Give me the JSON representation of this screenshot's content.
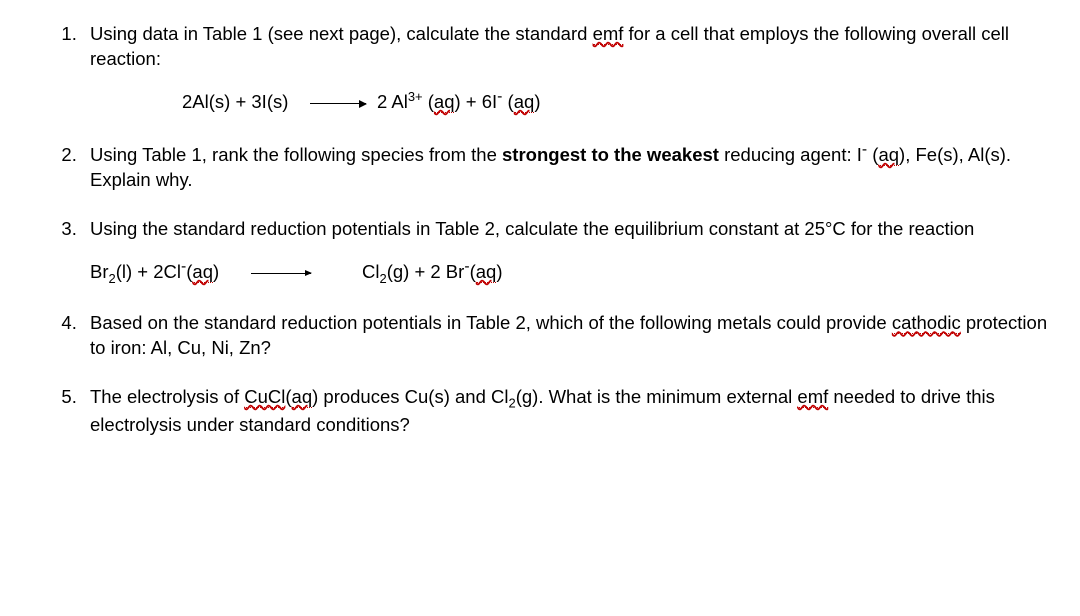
{
  "questions": {
    "q1": {
      "prefix": "Using data in Table 1 (see next page), calculate the standard ",
      "emf": "emf",
      "suffix": " for a cell that employs the following overall cell reaction:",
      "eq_left_a": "2Al(s) + 3I(s)",
      "eq_right_a": " 2 Al",
      "eq_right_b": "3+",
      "eq_right_c": " (",
      "eq_aq1": "aq",
      "eq_right_d": ") + 6I",
      "eq_neg": "-",
      "eq_right_e": " (",
      "eq_aq2": "aq",
      "eq_right_f": ")"
    },
    "q2": {
      "a": "Using Table 1, rank the following species from the ",
      "bold": "strongest to the weakest",
      "b": " reducing agent: I",
      "neg": "-",
      "c": " (",
      "aq": "aq",
      "d": "), Fe(s), Al(s). Explain why."
    },
    "q3": {
      "text": "Using the standard reduction potentials in Table 2, calculate the equilibrium constant at 25°C for the reaction",
      "eq_l1": "Br",
      "eq_l2": "2",
      "eq_l3": "(l) + 2Cl",
      "eq_lneg": "-",
      "eq_l4": "(",
      "eq_aq1": "aq",
      "eq_l5": ")",
      "eq_r1": "Cl",
      "eq_r2": "2",
      "eq_r3": "(g) + 2 Br",
      "eq_rneg": "-",
      "eq_r4": "(",
      "eq_aq2": "aq",
      "eq_r5": ")"
    },
    "q4": {
      "a": "Based on the standard reduction potentials in Table 2, which of the following metals could provide ",
      "cath": "cathodic",
      "b": " protection to iron: Al, Cu, Ni, Zn?"
    },
    "q5": {
      "a": "The electrolysis of ",
      "cucl": "CuCl",
      "b": "(",
      "aq": "aq",
      "c": ") produces Cu(s) and Cl",
      "sub2": "2",
      "d": "(g). What is the minimum external ",
      "emf": "emf",
      "e": " needed to drive this electrolysis under standard conditions?"
    }
  }
}
